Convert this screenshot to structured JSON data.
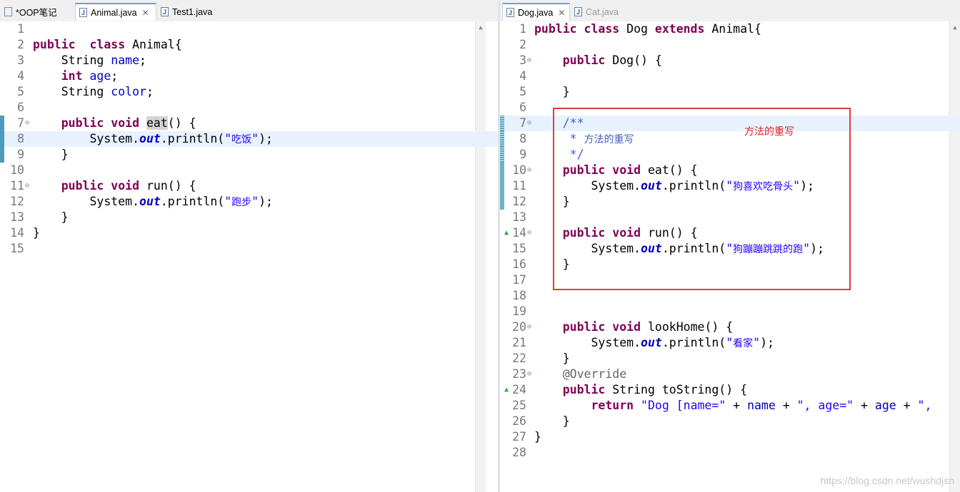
{
  "left_tabs": [
    {
      "label": "*OOP笔记",
      "icon": "note-file-icon",
      "active": false,
      "closable": false
    },
    {
      "label": "Animal.java",
      "icon": "java-file-icon",
      "active": true,
      "closable": true
    },
    {
      "label": "Test1.java",
      "icon": "java-file-icon",
      "active": false,
      "closable": false
    }
  ],
  "right_tabs": [
    {
      "label": "Dog.java",
      "icon": "java-file-icon",
      "active": true,
      "closable": true
    },
    {
      "label": "Cat.java",
      "icon": "java-file-icon",
      "active": false,
      "closable": false
    }
  ],
  "left_editor": {
    "lines": [
      {
        "n": "1",
        "tokens": []
      },
      {
        "n": "2",
        "tokens": [
          [
            "kw",
            "public"
          ],
          [
            "",
            "  "
          ],
          [
            "kw",
            "class"
          ],
          [
            "",
            " Animal{"
          ]
        ]
      },
      {
        "n": "3",
        "tokens": [
          [
            "",
            "    String "
          ],
          [
            "fld",
            "name"
          ],
          [
            "",
            ";"
          ]
        ]
      },
      {
        "n": "4",
        "tokens": [
          [
            "",
            "    "
          ],
          [
            "kw",
            "int"
          ],
          [
            "",
            " "
          ],
          [
            "fld",
            "age"
          ],
          [
            "",
            ";"
          ]
        ]
      },
      {
        "n": "5",
        "tokens": [
          [
            "",
            "    String "
          ],
          [
            "fld",
            "color"
          ],
          [
            "",
            ";"
          ]
        ]
      },
      {
        "n": "6",
        "tokens": []
      },
      {
        "n": "7",
        "fold": true,
        "mark": "a",
        "tokens": [
          [
            "",
            "    "
          ],
          [
            "kw",
            "public"
          ],
          [
            "",
            " "
          ],
          [
            "kw",
            "void"
          ],
          [
            "",
            " "
          ],
          [
            "occ",
            "eat"
          ],
          [
            "",
            "() {"
          ]
        ]
      },
      {
        "n": "8",
        "mark": "a",
        "highlight": true,
        "tokens": [
          [
            "",
            "        System."
          ],
          [
            "stf",
            "out"
          ],
          [
            "",
            ".println("
          ],
          [
            "str",
            "\""
          ],
          [
            "strzh",
            "吃饭"
          ],
          [
            "str",
            "\""
          ],
          [
            "",
            ");"
          ]
        ]
      },
      {
        "n": "9",
        "mark": "a",
        "tokens": [
          [
            "",
            "    }"
          ]
        ]
      },
      {
        "n": "10",
        "tokens": []
      },
      {
        "n": "11",
        "fold": true,
        "tokens": [
          [
            "",
            "    "
          ],
          [
            "kw",
            "public"
          ],
          [
            "",
            " "
          ],
          [
            "kw",
            "void"
          ],
          [
            "",
            " run() {"
          ]
        ]
      },
      {
        "n": "12",
        "tokens": [
          [
            "",
            "        System."
          ],
          [
            "stf",
            "out"
          ],
          [
            "",
            ".println("
          ],
          [
            "str",
            "\""
          ],
          [
            "strzh",
            "跑步"
          ],
          [
            "str",
            "\""
          ],
          [
            "",
            ");"
          ]
        ]
      },
      {
        "n": "13",
        "tokens": [
          [
            "",
            "    }"
          ]
        ]
      },
      {
        "n": "14",
        "tokens": [
          [
            "",
            "}"
          ]
        ]
      },
      {
        "n": "15",
        "tokens": []
      }
    ]
  },
  "right_editor": {
    "lines": [
      {
        "n": "1",
        "tokens": [
          [
            "kw",
            "public"
          ],
          [
            "",
            " "
          ],
          [
            "kw",
            "class"
          ],
          [
            "",
            " Dog "
          ],
          [
            "kw",
            "extends"
          ],
          [
            "",
            " Animal{"
          ]
        ]
      },
      {
        "n": "2",
        "tokens": []
      },
      {
        "n": "3",
        "fold": true,
        "tokens": [
          [
            "",
            "    "
          ],
          [
            "kw",
            "public"
          ],
          [
            "",
            " Dog() {"
          ]
        ]
      },
      {
        "n": "4",
        "tokens": []
      },
      {
        "n": "5",
        "tokens": [
          [
            "",
            "    }"
          ]
        ]
      },
      {
        "n": "6",
        "tokens": []
      },
      {
        "n": "7",
        "fold": true,
        "mark": "c",
        "highlight": true,
        "tokens": [
          [
            "",
            "    "
          ],
          [
            "cmt",
            "/**"
          ]
        ]
      },
      {
        "n": "8",
        "mark": "c",
        "tokens": [
          [
            "",
            "     "
          ],
          [
            "cmt",
            "* "
          ],
          [
            "cmtzh",
            "方法的重写"
          ]
        ]
      },
      {
        "n": "9",
        "mark": "c",
        "tokens": [
          [
            "",
            "     "
          ],
          [
            "cmt",
            "*/"
          ]
        ]
      },
      {
        "n": "10",
        "fold": true,
        "mark": "b",
        "tokens": [
          [
            "",
            "    "
          ],
          [
            "kw",
            "public"
          ],
          [
            "",
            " "
          ],
          [
            "kw",
            "void"
          ],
          [
            "",
            " eat() {"
          ]
        ]
      },
      {
        "n": "11",
        "mark": "b",
        "tokens": [
          [
            "",
            "        System."
          ],
          [
            "stf",
            "out"
          ],
          [
            "",
            ".println("
          ],
          [
            "str",
            "\""
          ],
          [
            "strzh",
            "狗喜欢吃骨头"
          ],
          [
            "str",
            "\""
          ],
          [
            "",
            ");"
          ]
        ]
      },
      {
        "n": "12",
        "mark": "b",
        "tokens": [
          [
            "",
            "    }"
          ]
        ]
      },
      {
        "n": "13",
        "tokens": []
      },
      {
        "n": "14",
        "override": true,
        "fold": true,
        "tokens": [
          [
            "",
            "    "
          ],
          [
            "kw",
            "public"
          ],
          [
            "",
            " "
          ],
          [
            "kw",
            "void"
          ],
          [
            "",
            " run() {"
          ]
        ]
      },
      {
        "n": "15",
        "tokens": [
          [
            "",
            "        System."
          ],
          [
            "stf",
            "out"
          ],
          [
            "",
            ".println("
          ],
          [
            "str",
            "\""
          ],
          [
            "strzh",
            "狗蹦蹦跳跳的跑"
          ],
          [
            "str",
            "\""
          ],
          [
            "",
            ");"
          ]
        ]
      },
      {
        "n": "16",
        "tokens": [
          [
            "",
            "    }"
          ]
        ]
      },
      {
        "n": "17",
        "tokens": []
      },
      {
        "n": "18",
        "tokens": []
      },
      {
        "n": "19",
        "tokens": []
      },
      {
        "n": "20",
        "fold": true,
        "tokens": [
          [
            "",
            "    "
          ],
          [
            "kw",
            "public"
          ],
          [
            "",
            " "
          ],
          [
            "kw",
            "void"
          ],
          [
            "",
            " lookHome() {"
          ]
        ]
      },
      {
        "n": "21",
        "tokens": [
          [
            "",
            "        System."
          ],
          [
            "stf",
            "out"
          ],
          [
            "",
            ".println("
          ],
          [
            "str",
            "\""
          ],
          [
            "strzh",
            "看家"
          ],
          [
            "str",
            "\""
          ],
          [
            "",
            ");"
          ]
        ]
      },
      {
        "n": "22",
        "tokens": [
          [
            "",
            "    }"
          ]
        ]
      },
      {
        "n": "23",
        "fold": true,
        "tokens": [
          [
            "",
            "    "
          ],
          [
            "ann",
            "@Override"
          ]
        ]
      },
      {
        "n": "24",
        "override": true,
        "tokens": [
          [
            "",
            "    "
          ],
          [
            "kw",
            "public"
          ],
          [
            "",
            " String toString() {"
          ]
        ]
      },
      {
        "n": "25",
        "tokens": [
          [
            "",
            "        "
          ],
          [
            "kw",
            "return"
          ],
          [
            "",
            " "
          ],
          [
            "str",
            "\"Dog [name=\""
          ],
          [
            "",
            " + "
          ],
          [
            "fld",
            "name"
          ],
          [
            "",
            " + "
          ],
          [
            "str",
            "\", age=\""
          ],
          [
            "",
            " + "
          ],
          [
            "fld",
            "age"
          ],
          [
            "",
            " + "
          ],
          [
            "str",
            "\","
          ]
        ]
      },
      {
        "n": "26",
        "tokens": [
          [
            "",
            "    }"
          ]
        ]
      },
      {
        "n": "27",
        "tokens": [
          [
            "",
            "}"
          ]
        ]
      },
      {
        "n": "28",
        "tokens": []
      }
    ]
  },
  "annotation": {
    "label": "方法的重写",
    "color": "#e02020"
  },
  "watermark": "https://blog.csdn.net/wushdjsn",
  "colors": {
    "keyword": "#7f0055",
    "field": "#0000c0",
    "string": "#2a00ff",
    "comment": "#3f5fbf",
    "annotation": "#646464",
    "line_highlight": "#e8f2fe"
  }
}
